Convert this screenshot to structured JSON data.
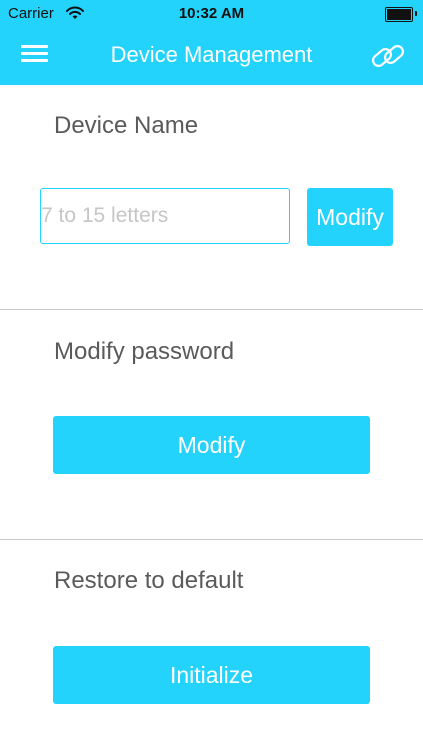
{
  "status_bar": {
    "carrier": "Carrier",
    "time": "10:32 AM"
  },
  "nav": {
    "title": "Device Management",
    "menu_icon": "hamburger-menu-icon",
    "link_icon": "link-chain-icon"
  },
  "device_name": {
    "title": "Device Name",
    "input_value": "",
    "input_placeholder": "7 to 15 letters",
    "button_label": "Modify"
  },
  "password": {
    "title": "Modify password",
    "button_label": "Modify"
  },
  "restore": {
    "title": "Restore to default",
    "button_label": "Initialize"
  },
  "colors": {
    "accent": "#24d3fb",
    "text_gray": "#5a5a5a",
    "placeholder_gray": "#c6c6c6",
    "divider": "#c8c8c8"
  }
}
